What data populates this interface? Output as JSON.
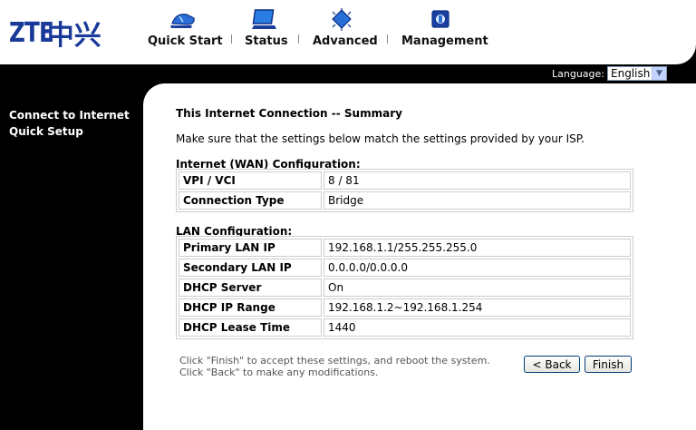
{
  "logo": {
    "text": "ZTE",
    "chinese": "中兴"
  },
  "nav": [
    {
      "label": "Quick Start",
      "icon": "shoe-icon"
    },
    {
      "label": "Status",
      "icon": "monitor-icon"
    },
    {
      "label": "Advanced",
      "icon": "chip-icon"
    },
    {
      "label": "Management",
      "icon": "toolbox-icon"
    }
  ],
  "language": {
    "label": "Language:",
    "value": "English"
  },
  "sidebar": {
    "items": [
      "Connect to Internet",
      "Quick Setup"
    ]
  },
  "page": {
    "title": "This Internet Connection -- Summary",
    "intro": "Make sure that the settings below match the settings provided by your ISP."
  },
  "wan": {
    "heading": "Internet (WAN) Configuration:",
    "rows": [
      {
        "key": "VPI / VCI",
        "value": "8 / 81"
      },
      {
        "key": "Connection Type",
        "value": "Bridge"
      }
    ]
  },
  "lan": {
    "heading": "LAN Configuration:",
    "rows": [
      {
        "key": "Primary LAN IP",
        "value": "192.168.1.1/255.255.255.0"
      },
      {
        "key": "Secondary LAN IP",
        "value": "0.0.0.0/0.0.0.0"
      },
      {
        "key": "DHCP Server",
        "value": "On"
      },
      {
        "key": "DHCP IP Range",
        "value": "192.168.1.2~192.168.1.254"
      },
      {
        "key": "DHCP Lease Time",
        "value": "1440"
      }
    ]
  },
  "footer": {
    "note1": "Click \"Finish\" to accept these settings, and reboot the system.",
    "note2": "Click \"Back\" to make any modifications.",
    "back_label": "< Back",
    "finish_label": "Finish"
  },
  "colors": {
    "brand": "#1a3a9a",
    "background": "#000000",
    "panel": "#ffffff"
  }
}
